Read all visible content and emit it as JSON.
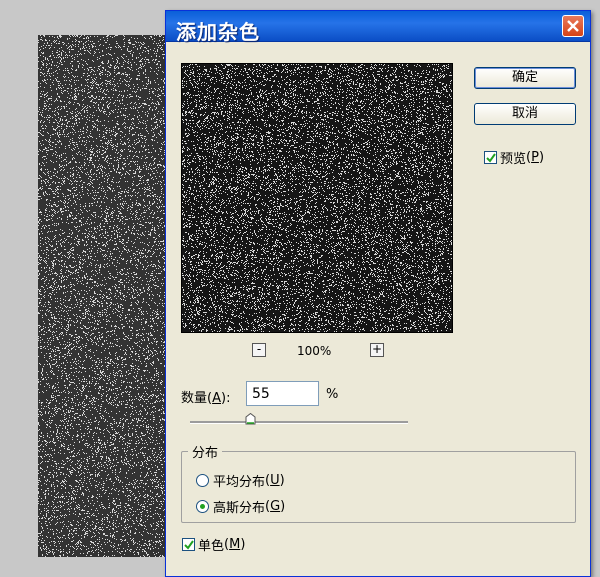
{
  "dialog": {
    "title": "添加杂色",
    "ok_label": "确定",
    "cancel_label": "取消",
    "preview_checkbox": {
      "text": "预览",
      "mnemonic": "P",
      "checked": true
    },
    "zoom": {
      "minus": "-",
      "plus": "+",
      "value": "100%"
    },
    "amount": {
      "label": "数量",
      "mnemonic": "A",
      "value": "55",
      "unit": "%"
    },
    "slider": {
      "value_fraction": 0.275
    },
    "distribution": {
      "legend": "分布",
      "options": [
        {
          "text": "平均分布",
          "mnemonic": "U",
          "selected": false
        },
        {
          "text": "高斯分布",
          "mnemonic": "G",
          "selected": true
        }
      ]
    },
    "monochrome_checkbox": {
      "text": "单色",
      "mnemonic": "M",
      "checked": true
    }
  },
  "colors": {
    "titlebar": "#0a5fd8",
    "dialog_bg": "#ece9d8",
    "close_button": "#d64317",
    "check_mark": "#21a121",
    "desktop_bg": "#c8c8c8"
  }
}
